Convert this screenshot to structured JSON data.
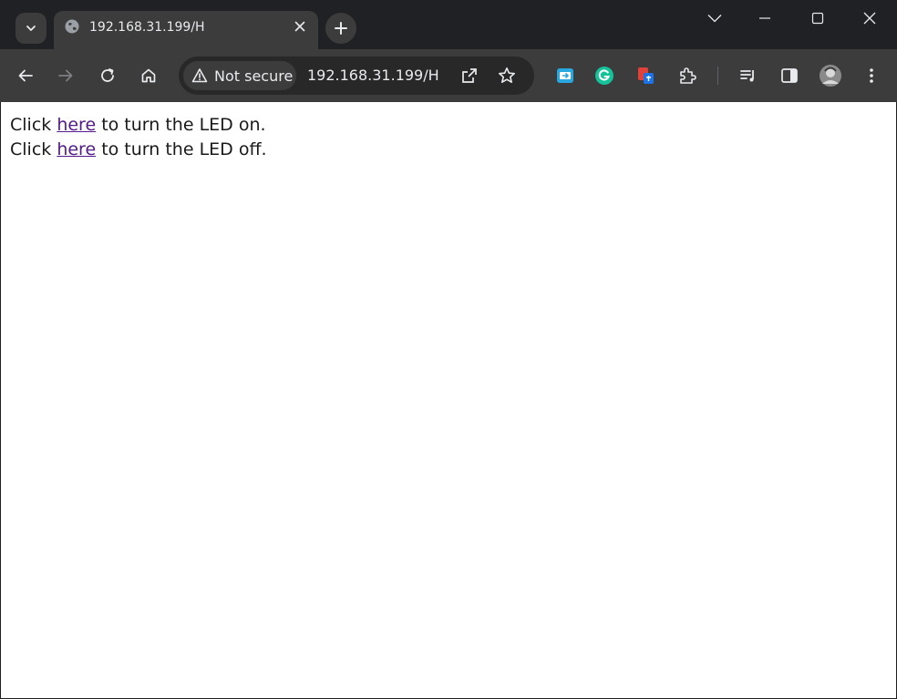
{
  "tab": {
    "title": "192.168.31.199/H",
    "favicon": "globe-icon"
  },
  "toolbar": {
    "security_label": "Not secure",
    "url": "192.168.31.199/H"
  },
  "extensions": [
    "screen-capture-extension-icon",
    "grammarly-extension-icon",
    "translate-extension-icon",
    "puzzle-extensions-icon"
  ],
  "page": {
    "lines": [
      {
        "prefix": "Click ",
        "link": "here",
        "suffix": " to turn the LED on."
      },
      {
        "prefix": "Click ",
        "link": "here",
        "suffix": " to turn the LED off."
      }
    ]
  },
  "colors": {
    "visited_link": "#551a8b",
    "chrome_dark": "#202124",
    "toolbar": "#3c3c3c"
  }
}
